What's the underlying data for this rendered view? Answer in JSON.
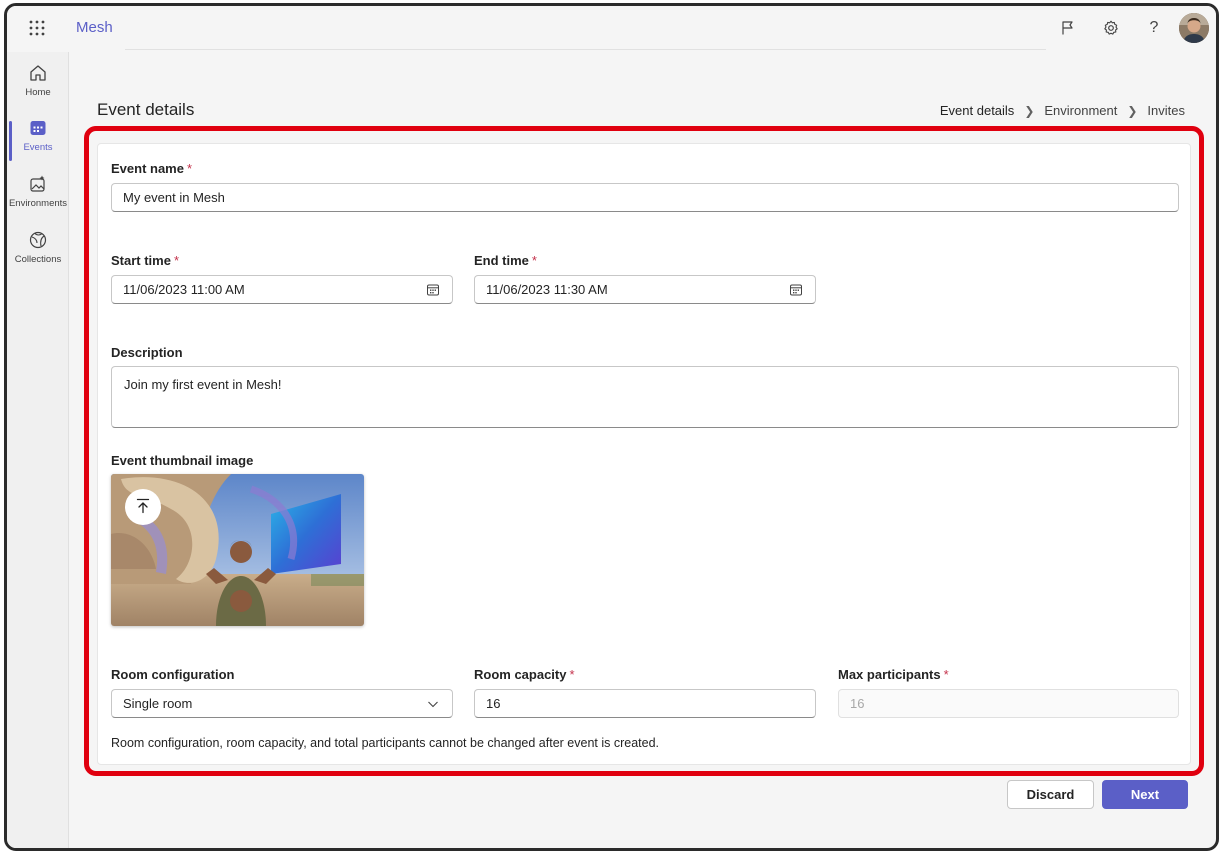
{
  "app": {
    "title": "Mesh"
  },
  "rail": {
    "items": [
      {
        "label": "Home",
        "icon": "home-icon"
      },
      {
        "label": "Events",
        "icon": "calendar-icon",
        "active": true
      },
      {
        "label": "Environments",
        "icon": "image-sparkle-icon"
      },
      {
        "label": "Collections",
        "icon": "collection-icon"
      }
    ]
  },
  "header": {
    "page_title": "Event details",
    "breadcrumb": [
      "Event details",
      "Environment",
      "Invites"
    ]
  },
  "form": {
    "event_name": {
      "label": "Event name",
      "value": "My event in Mesh",
      "required_mark": "*"
    },
    "start_time": {
      "label": "Start time",
      "value": "11/06/2023 11:00 AM",
      "required_mark": "*"
    },
    "end_time": {
      "label": "End time",
      "value": "11/06/2023 11:30 AM",
      "required_mark": "*"
    },
    "description": {
      "label": "Description",
      "value": "Join my first event in Mesh!"
    },
    "thumbnail": {
      "label": "Event thumbnail image"
    },
    "room_configuration": {
      "label": "Room configuration",
      "value": "Single room"
    },
    "room_capacity": {
      "label": "Room capacity",
      "value": "16",
      "required_mark": "*"
    },
    "max_participants": {
      "label": "Max participants",
      "value": "16",
      "required_mark": "*"
    },
    "note": "Room configuration, room capacity, and total participants cannot be changed after event is created."
  },
  "actions": {
    "discard": "Discard",
    "next": "Next"
  },
  "colors": {
    "accent": "#5b5fc7",
    "required": "#c4314b",
    "highlight": "#e0000f"
  }
}
